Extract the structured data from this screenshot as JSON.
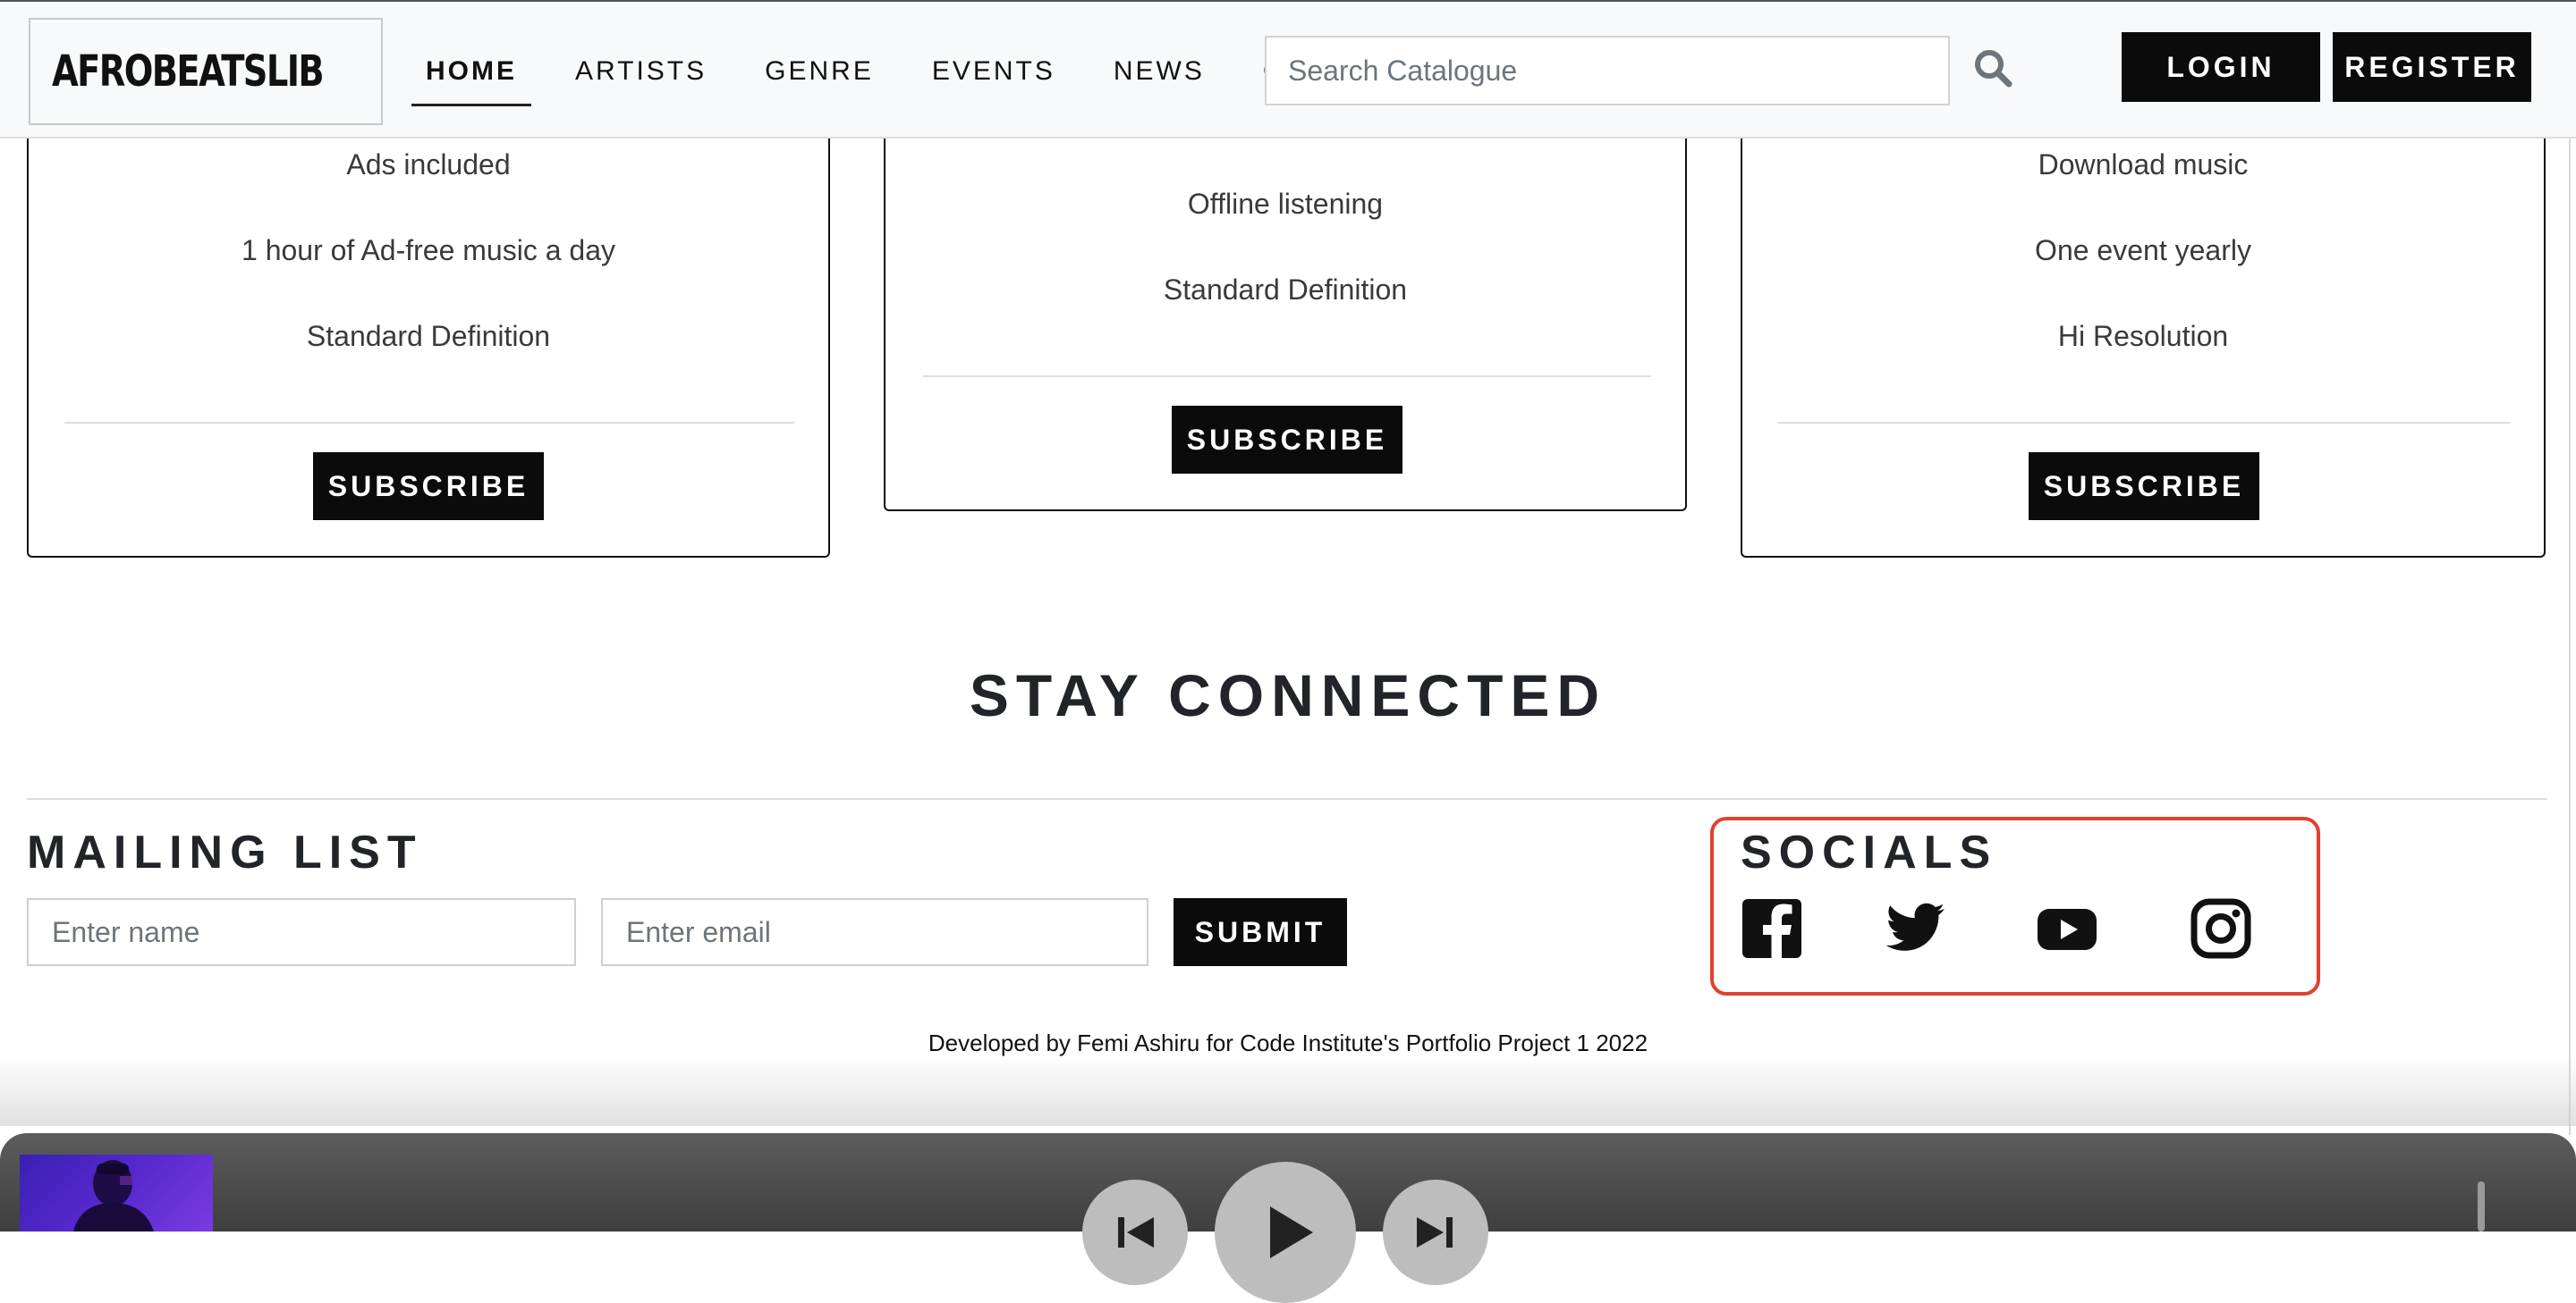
{
  "header": {
    "logo_text": "AFROBEATSLIB",
    "nav": [
      "HOME",
      "ARTISTS",
      "GENRE",
      "EVENTS",
      "NEWS",
      "CONTACT"
    ],
    "active_nav": "HOME",
    "search_placeholder": "Search Catalogue",
    "login_label": "LOGIN",
    "register_label": "REGISTER"
  },
  "plans": [
    {
      "features": [
        "Ads included",
        "1 hour of Ad-free music a day",
        "Standard Definition"
      ],
      "button": "SUBSCRIBE"
    },
    {
      "features": [
        "Offline listening",
        "Standard Definition"
      ],
      "button": "SUBSCRIBE"
    },
    {
      "features": [
        "Download music",
        "One event yearly",
        "Hi Resolution"
      ],
      "button": "SUBSCRIBE"
    }
  ],
  "stay_connected": {
    "title": "STAY CONNECTED",
    "mailing_list": {
      "title": "MAILING LIST",
      "name_placeholder": "Enter name",
      "email_placeholder": "Enter email",
      "submit_label": "SUBMIT"
    },
    "socials": {
      "title": "SOCIALS",
      "icons": [
        "facebook-icon",
        "twitter-icon",
        "youtube-icon",
        "instagram-icon"
      ],
      "highlight_color": "#e0422b"
    }
  },
  "footer": {
    "credits": "Developed by Femi Ashiru for Code Institute's Portfolio Project 1 2022"
  },
  "player": {
    "controls": [
      "previous-icon",
      "play-icon",
      "next-icon"
    ]
  }
}
